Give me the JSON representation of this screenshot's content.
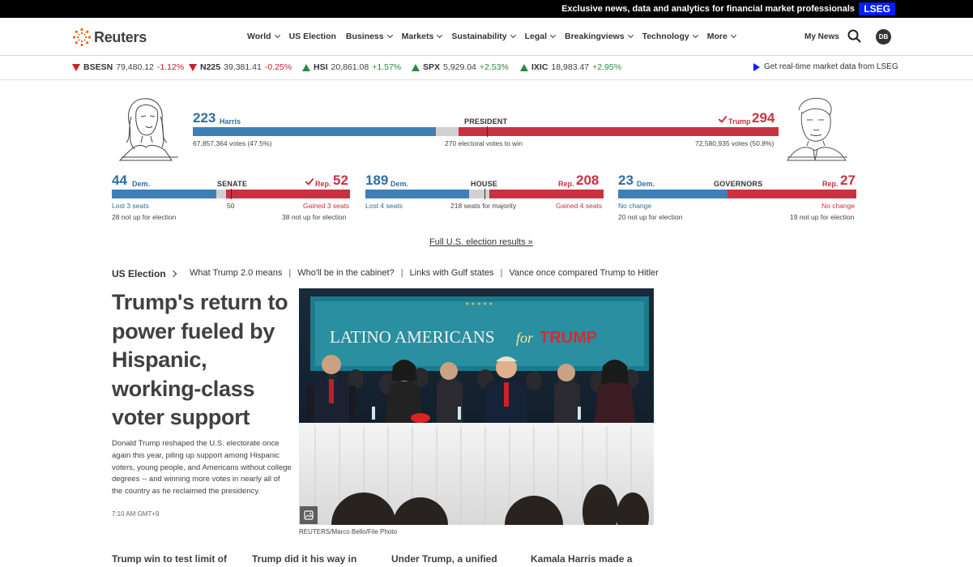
{
  "topbar": {
    "text": "Exclusive news, data and analytics for financial market professionals",
    "badge": "LSEG"
  },
  "header": {
    "logo": "Reuters",
    "nav": [
      "World",
      "US Election",
      "Business",
      "Markets",
      "Sustainability",
      "Legal",
      "Breakingviews",
      "Technology",
      "More"
    ],
    "nav_has_dropdown": [
      true,
      false,
      true,
      true,
      true,
      true,
      true,
      true,
      true
    ],
    "my_news": "My News",
    "avatar_initials": "DB"
  },
  "ticker": {
    "items": [
      {
        "symbol": "BSESN",
        "value": "79,480.12",
        "change": "-1.12%",
        "direction": "down"
      },
      {
        "symbol": "N225",
        "value": "39,381.41",
        "change": "-0.25%",
        "direction": "down"
      },
      {
        "symbol": "HSI",
        "value": "20,861.08",
        "change": "+1.57%",
        "direction": "up"
      },
      {
        "symbol": "SPX",
        "value": "5,929.04",
        "change": "+2.53%",
        "direction": "up"
      },
      {
        "symbol": "IXIC",
        "value": "18,983.47",
        "change": "+2.95%",
        "direction": "up"
      }
    ],
    "lseg_link": "Get real-time market data from LSEG"
  },
  "president": {
    "label": "PRESIDENT",
    "harris_count": "223",
    "harris_name": "Harris",
    "harris_votes": "67,857,364 votes (47.5%)",
    "trump_count": "294",
    "trump_name": "Trump",
    "trump_votes": "72,580,935 votes (50.8%)",
    "threshold": "270 electoral votes to win",
    "dem_value": 223,
    "rep_value": 294,
    "total": 538
  },
  "senate": {
    "label": "SENATE",
    "dem_count": "44",
    "dem_label": "Dem.",
    "rep_count": "52",
    "rep_label": "Rep.",
    "mid": "50",
    "dem_change": "Lost 3 seats",
    "rep_change": "Gained 3 seats",
    "dem_note": "28 not up for election",
    "rep_note": "38 not up for election",
    "dem_value": 44,
    "rep_value": 52,
    "total": 100
  },
  "house": {
    "label": "HOUSE",
    "dem_count": "189",
    "dem_label": "Dem.",
    "rep_count": "208",
    "rep_label": "Rep.",
    "mid": "218 seats for majority",
    "dem_change": "Lost 4 seats",
    "rep_change": "Gained 4 seats",
    "dem_value": 189,
    "rep_value": 208,
    "total": 435
  },
  "governors": {
    "label": "GOVERNORS",
    "dem_count": "23",
    "dem_label": "Dem.",
    "rep_count": "27",
    "rep_label": "Rep.",
    "dem_change": "No change",
    "rep_change": "No change",
    "dem_note": "20 not up for election",
    "rep_note": "19 not up for election",
    "dem_value": 23,
    "rep_value": 27,
    "total": 50
  },
  "full_results": "Full U.S. election results »",
  "election_nav": {
    "title": "US Election",
    "links": [
      "What Trump 2.0 means",
      "Who'll be in the cabinet?",
      "Links with Gulf states",
      "Vance once compared Trump to Hitler"
    ]
  },
  "story": {
    "headline": "Trump's return to power fueled by Hispanic, working-class voter support",
    "summary": "Donald Trump reshaped the U.S. electorate once again this year, piling up support among Hispanic voters, young people, and Americans without college degrees -- and winning more votes in nearly all of the country as he reclaimed the presidency.",
    "time": "7:10 AM GMT+9",
    "photo_banner_1": "LATINO AMERICANS",
    "photo_banner_2": "for",
    "photo_banner_3": "TRUMP",
    "caption": "REUTERS/Marco Bello/File Photo"
  },
  "teasers": [
    "Trump win to test limit of",
    "Trump did it his way in",
    "Under Trump, a unified",
    "Kamala Harris made a"
  ],
  "colors": {
    "dem": "#3f7fb8",
    "rep": "#c8313f",
    "neutral": "#d1d1d1",
    "lseg": "#001eff"
  }
}
